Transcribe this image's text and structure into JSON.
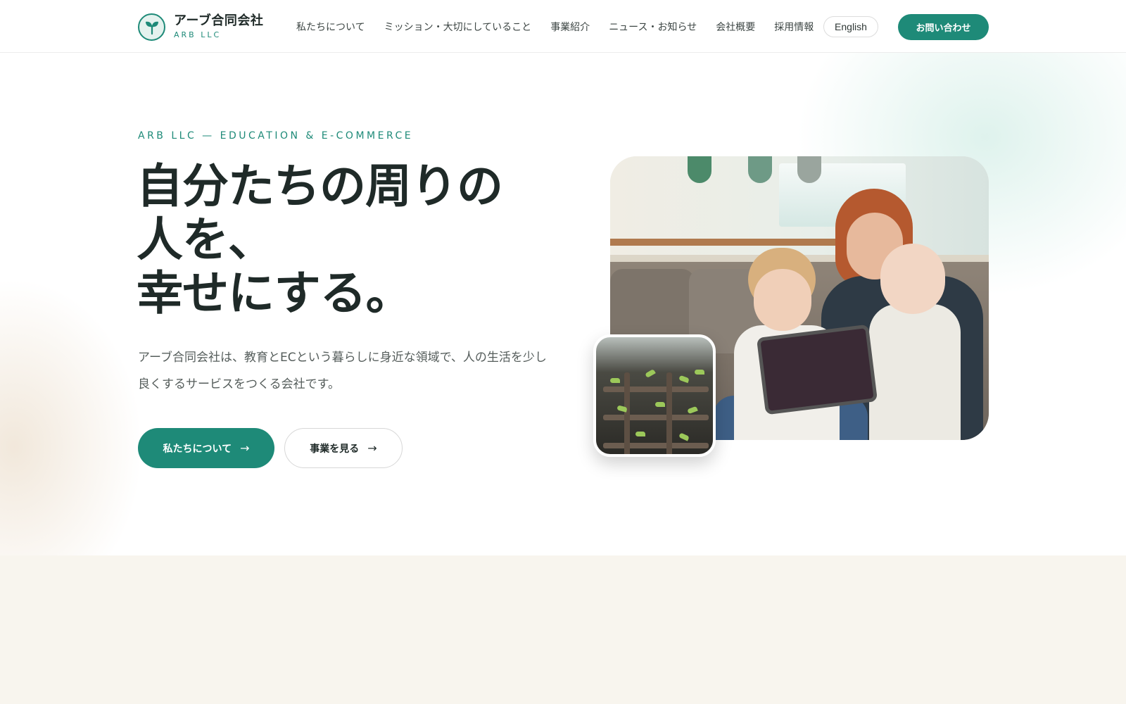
{
  "header": {
    "logo_name": "アーブ合同会社",
    "logo_sub": "ARB LLC",
    "nav": [
      {
        "label": "私たちについて"
      },
      {
        "label": "ミッション・大切にしていること"
      },
      {
        "label": "事業紹介"
      },
      {
        "label": "ニュース・お知らせ"
      },
      {
        "label": "会社概要"
      },
      {
        "label": "採用情報"
      }
    ],
    "lang_label": "English",
    "contact_label": "お問い合わせ"
  },
  "hero": {
    "eyebrow": "ARB LLC — EDUCATION & E-COMMERCE",
    "headline": [
      "自分たちの周りの",
      "人を、",
      "幸せにする。"
    ],
    "lead": "アーブ合同会社は、教育とECという暮らしに身近な領域で、人の生活を少し良くするサービスをつくる会社です。",
    "primary_button": "私たちについて",
    "secondary_button": "事業を見る",
    "arrow": "→"
  },
  "colors": {
    "brand": "#1e8a78",
    "text": "#1f2a28",
    "lower_bg": "#f8f5ee"
  },
  "icons": {
    "logo": "sprout-icon",
    "button_arrow": "arrow-right-icon"
  }
}
